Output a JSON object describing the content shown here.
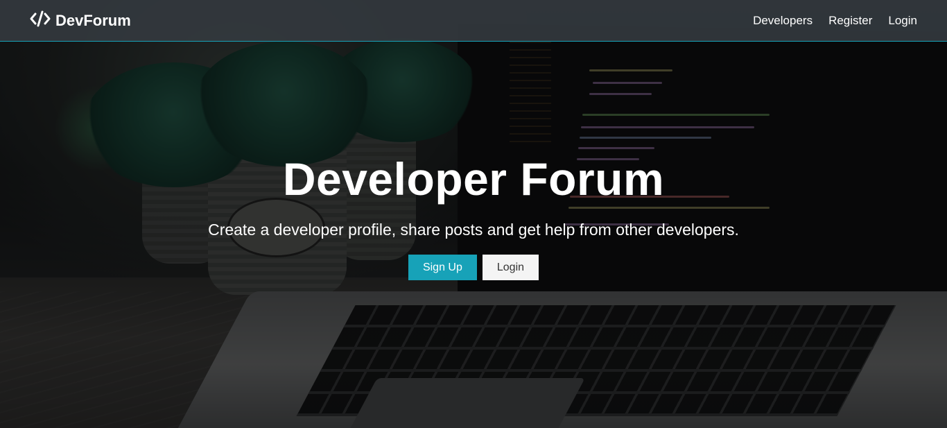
{
  "brand": {
    "icon": "code-icon",
    "name": "DevForum"
  },
  "nav": {
    "items": [
      {
        "label": "Developers"
      },
      {
        "label": "Register"
      },
      {
        "label": "Login"
      }
    ]
  },
  "hero": {
    "title": "Developer Forum",
    "lead": "Create a developer profile, share posts and get help from other developers.",
    "signup_label": "Sign Up",
    "login_label": "Login"
  },
  "colors": {
    "accent": "#17a2b8",
    "navbar": "#343a40",
    "light_button": "#f4f4f4"
  }
}
